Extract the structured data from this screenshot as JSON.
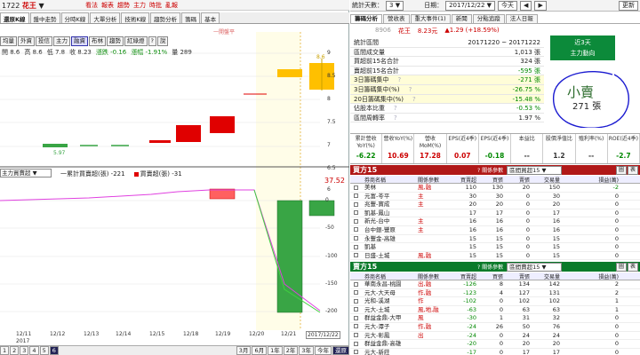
{
  "left": {
    "stock_code": "1722",
    "stock_name": "花王",
    "top_links": [
      "看法",
      "報表",
      "趨勢",
      "主力",
      "時批",
      "亂報"
    ],
    "tabs": [
      "還原K線",
      "盤中走勢",
      "分時K線",
      "大單分析",
      "技術K線",
      "趨勢分析",
      "籌碼",
      "基本"
    ],
    "marquee": "一開盤平",
    "sub_buttons": [
      "均量",
      "外資",
      "投信",
      "主力",
      "融資",
      "布林",
      "趨勢",
      "紅綠燈",
      "?",
      "說"
    ],
    "values": {
      "open": "開 8.6",
      "high": "高 8.6",
      "low": "低 7.8",
      "close": "收 8.23",
      "change": "漲跌 -0.16",
      "pct": "漲幅 -1.91%",
      "vol": "量 289"
    },
    "price_axis": [
      "9",
      "8.5",
      "8",
      "7.5",
      "7",
      "6.5",
      "6",
      "5.5",
      "5"
    ],
    "price_marks": {
      "high": "8.6",
      "low": "5.97"
    },
    "mid_select": "主力買賣超",
    "mid_legend": {
      "acc": "一累計買賣超(張) -221",
      "daily": "買賣超(張) -31"
    },
    "mid_value": "37.52",
    "mid_axis": [
      "0",
      "-50",
      "-100",
      "-150",
      "-200"
    ],
    "x_labels": [
      "12/11",
      "12/12",
      "12/13",
      "12/14",
      "12/15",
      "12/18",
      "12/19",
      "12/20",
      "12/21",
      "2017/12/22"
    ],
    "x_year": "2017",
    "pages": [
      "1",
      "2",
      "3",
      "4",
      "5",
      "6"
    ],
    "periods": [
      "3月",
      "6月",
      "1年",
      "2年",
      "3年",
      "今年",
      "還原"
    ]
  },
  "right": {
    "period_label": "統計天數：",
    "period_value": "3",
    "date_label": "日期：",
    "date_value": "2017/12/22",
    "today_btn": "今天",
    "tabs": [
      "籌碼分析",
      "營收表",
      "重大事件(1)",
      "新聞",
      "分點追蹤",
      "法人日報"
    ],
    "head": {
      "code": "8906",
      "name": "花王",
      "price": "8.23元",
      "change": "▲1.29 (+18.59%)"
    },
    "stats": [
      {
        "k": "統計區間",
        "v": "20171220 ~ 20171222"
      },
      {
        "k": "區間成交量",
        "v": "1,013 張"
      },
      {
        "k": "買超前15名合計",
        "v": "324 張"
      },
      {
        "k": "賣超前15名合計",
        "v": "-595 張"
      },
      {
        "k": "3日籌碼集中",
        "v": "-271 張"
      },
      {
        "k": "3日籌碼集中(%)",
        "v": "-26.75 %"
      },
      {
        "k": "20日籌碼集中(%)",
        "v": "-15.48 %"
      },
      {
        "k": "佔股本比重",
        "v": "-0.53 %"
      },
      {
        "k": "區間周轉率",
        "v": "1.97 %"
      }
    ],
    "callout": {
      "line1": "近3天",
      "line2": "主力動向",
      "sell": "小賣",
      "amount": "271 張"
    },
    "fin": [
      {
        "h": "累計營收YoY(%)",
        "v": "-6.22",
        "c": "g"
      },
      {
        "h": "營收YoY(%)",
        "v": "10.69",
        "c": "r"
      },
      {
        "h": "營收MoM(%)",
        "v": "17.28",
        "c": "r"
      },
      {
        "h": "EPS(近4季)",
        "v": "0.07",
        "c": "r"
      },
      {
        "h": "EPS(近4季)",
        "v": "-0.18",
        "c": "g"
      },
      {
        "h": "本益比",
        "v": "--",
        "c": ""
      },
      {
        "h": "股價淨值比",
        "v": "1.2",
        "c": ""
      },
      {
        "h": "殖利率(%)",
        "v": "--",
        "c": ""
      },
      {
        "h": "ROE(近4季)",
        "v": "-2.7",
        "c": "g"
      }
    ],
    "buy_panel": {
      "title": "買方15",
      "note": "關係參數",
      "select": "區間買超15",
      "tools": [
        "圖",
        "表"
      ],
      "cols": [
        "券商名稱",
        "關係參數",
        "買賣超",
        "買張",
        "賣張",
        "交易量",
        "損益(萬)"
      ],
      "rows": [
        {
          "name": "美林",
          "tag": "風,融",
          "net": "110",
          "buy": "130",
          "sell": "20",
          "vol": "150",
          "pl": "-2"
        },
        {
          "name": "元富-苓平",
          "tag": "主",
          "net": "30",
          "buy": "30",
          "sell": "0",
          "vol": "30",
          "pl": "0"
        },
        {
          "name": "兆豐-寶成",
          "tag": "主",
          "net": "20",
          "buy": "20",
          "sell": "0",
          "vol": "20",
          "pl": "0"
        },
        {
          "name": "凱基-鳳山",
          "tag": "",
          "net": "17",
          "buy": "17",
          "sell": "0",
          "vol": "17",
          "pl": "0"
        },
        {
          "name": "新光-台中",
          "tag": "主",
          "net": "16",
          "buy": "16",
          "sell": "0",
          "vol": "16",
          "pl": "0"
        },
        {
          "name": "台中銀-豐原",
          "tag": "主",
          "net": "16",
          "buy": "16",
          "sell": "0",
          "vol": "16",
          "pl": "0"
        },
        {
          "name": "永豐金-高雄",
          "tag": "",
          "net": "15",
          "buy": "15",
          "sell": "0",
          "vol": "15",
          "pl": "0"
        },
        {
          "name": "凱基",
          "tag": "",
          "net": "15",
          "buy": "15",
          "sell": "0",
          "vol": "15",
          "pl": "0"
        },
        {
          "name": "日盛-土城",
          "tag": "風,融",
          "net": "15",
          "buy": "15",
          "sell": "0",
          "vol": "15",
          "pl": "0"
        }
      ]
    },
    "sell_panel": {
      "title": "賣方15",
      "select": "區間賣超15",
      "tools": [
        "圖",
        "表"
      ],
      "cols": [
        "券商名稱",
        "關係參數",
        "買賣超",
        "買張",
        "賣張",
        "交易量",
        "損益(萬)"
      ],
      "rows": [
        {
          "name": "華南永昌-桃園",
          "tag": "出,融",
          "net": "-126",
          "buy": "8",
          "sell": "134",
          "vol": "142",
          "pl": "2"
        },
        {
          "name": "元大-大天母",
          "tag": "作,融",
          "net": "-123",
          "buy": "4",
          "sell": "127",
          "vol": "131",
          "pl": "2"
        },
        {
          "name": "光和-溪湖",
          "tag": "作",
          "net": "-102",
          "buy": "0",
          "sell": "102",
          "vol": "102",
          "pl": "1"
        },
        {
          "name": "元大-土城",
          "tag": "風,地,融",
          "net": "-63",
          "buy": "0",
          "sell": "63",
          "vol": "63",
          "pl": "1"
        },
        {
          "name": "群益金鼎-大甲",
          "tag": "風",
          "net": "-30",
          "buy": "1",
          "sell": "31",
          "vol": "32",
          "pl": "0"
        },
        {
          "name": "元大-潭子",
          "tag": "作,融",
          "net": "-24",
          "buy": "26",
          "sell": "50",
          "vol": "76",
          "pl": "0"
        },
        {
          "name": "元大-彰鳳",
          "tag": "出",
          "net": "-24",
          "buy": "0",
          "sell": "24",
          "vol": "24",
          "pl": "0"
        },
        {
          "name": "群益金鼎-高雄",
          "tag": "",
          "net": "-20",
          "buy": "0",
          "sell": "20",
          "vol": "20",
          "pl": "0"
        },
        {
          "name": "元大-新莊",
          "tag": "",
          "net": "-17",
          "buy": "0",
          "sell": "17",
          "vol": "17",
          "pl": "0"
        }
      ]
    }
  },
  "colors": {
    "up": "#e00000",
    "down": "#39a545",
    "accent": "#b01818",
    "green_panel": "#0a7a2a"
  }
}
